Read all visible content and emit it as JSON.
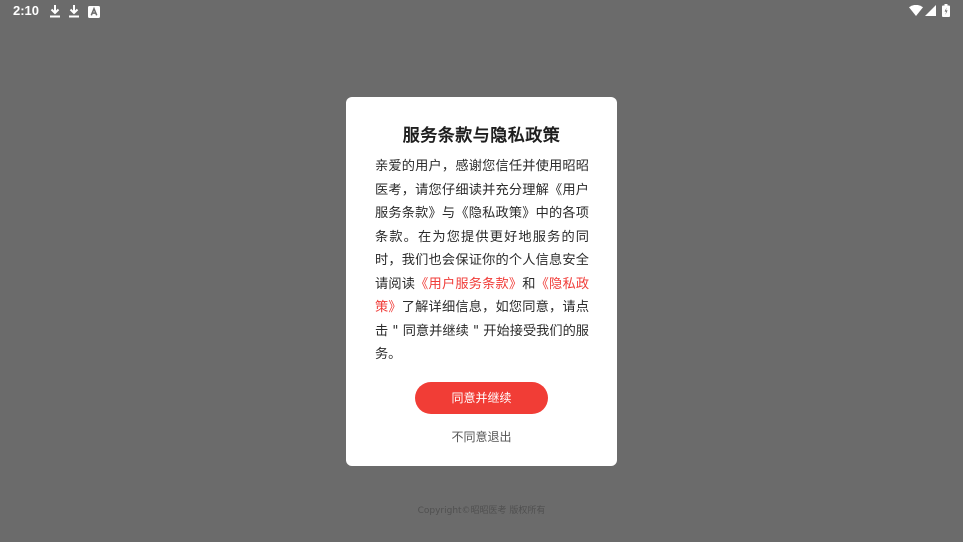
{
  "status_bar": {
    "time": "2:10",
    "icons": [
      "download-icon",
      "download-icon",
      "app-notification-icon",
      "wifi-icon",
      "signal-icon",
      "battery-icon"
    ]
  },
  "dialog": {
    "title": "服务条款与隐私政策",
    "body_part1": "亲爱的用户，感谢您信任并使用昭昭医考，请您仔细读并充分理解《用户服务条款》与《隐私政策》中的各项条款。在为您提供更好地服务的同时，我们也会保证你的个人信息安全请阅读",
    "link_terms": "《用户服务条款》",
    "body_and": "和",
    "link_privacy": "《隐私政策》",
    "body_part2": "了解详细信息，如您同意，请点击 \" 同意并继续 \" 开始接受我们的服务。",
    "agree_label": "同意并继续",
    "disagree_label": "不同意退出"
  },
  "footer": {
    "copyright": "Copyright©昭昭医考 版权所有"
  },
  "colors": {
    "overlay": "#6b6b6b",
    "accent": "#f13d36",
    "link": "#f03c38"
  }
}
